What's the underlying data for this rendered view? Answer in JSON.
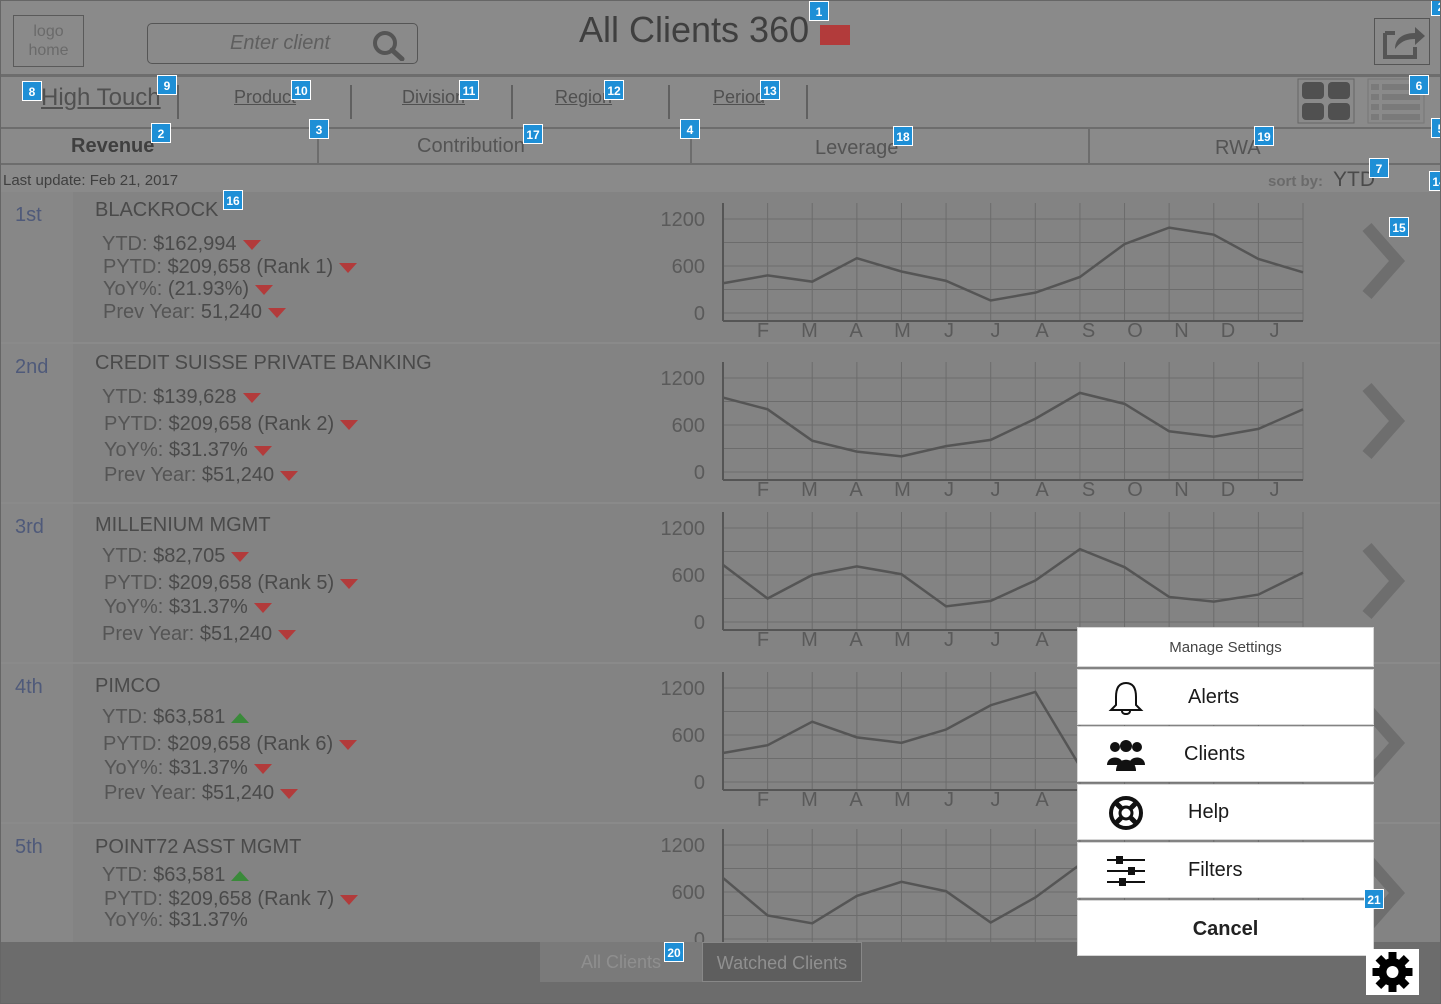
{
  "header": {
    "logo_text": "logo home",
    "search_placeholder": "Enter client",
    "title": "All Clients 360"
  },
  "filters": {
    "items": [
      "High Touch",
      "Product",
      "Division",
      "Region",
      "Period"
    ]
  },
  "metric_tabs": [
    "Revenue",
    "Contribution",
    "Leverage",
    "RWA"
  ],
  "status": {
    "last_update": "Last update: Feb 21, 2017",
    "sort_label": "sort by:",
    "sort_value": "YTD"
  },
  "chart_axes": {
    "y_ticks": [
      "1200",
      "600",
      "0"
    ],
    "months": [
      "F",
      "M",
      "A",
      "M",
      "J",
      "J",
      "A",
      "S",
      "O",
      "N",
      "D",
      "J"
    ]
  },
  "clients": [
    {
      "rank": "1st",
      "name": "BLACKROCK",
      "ytd_label": "YTD:",
      "ytd": "$162,994",
      "ytd_dir": "down",
      "pytd_label": "PYTD:",
      "pytd": "$209,658 (Rank 1)",
      "pytd_dir": "down",
      "yoy_label": "YoY%:",
      "yoy": "(21.93%)",
      "yoy_dir": "down",
      "prev_label": "Prev Year:",
      "prev": "51,240",
      "prev_dir": "down"
    },
    {
      "rank": "2nd",
      "name": "CREDIT SUISSE PRIVATE BANKING",
      "ytd_label": "YTD:",
      "ytd": "$139,628",
      "ytd_dir": "down",
      "pytd_label": "PYTD:",
      "pytd": "$209,658 (Rank 2)",
      "pytd_dir": "down",
      "yoy_label": "YoY%:",
      "yoy": "$31.37%",
      "yoy_dir": "down",
      "prev_label": "Prev Year:",
      "prev": "$51,240",
      "prev_dir": "down"
    },
    {
      "rank": "3rd",
      "name": "MILLENIUM MGMT",
      "ytd_label": "YTD:",
      "ytd": "$82,705",
      "ytd_dir": "down",
      "pytd_label": "PYTD:",
      "pytd": "$209,658 (Rank 5)",
      "pytd_dir": "down",
      "yoy_label": "YoY%:",
      "yoy": "$31.37%",
      "yoy_dir": "down",
      "prev_label": "Prev Year:",
      "prev": "$51,240",
      "prev_dir": "down"
    },
    {
      "rank": "4th",
      "name": "PIMCO",
      "ytd_label": "YTD:",
      "ytd": "$63,581",
      "ytd_dir": "up",
      "pytd_label": "PYTD:",
      "pytd": "$209,658 (Rank 6)",
      "pytd_dir": "down",
      "yoy_label": "YoY%:",
      "yoy": "$31.37%",
      "yoy_dir": "down",
      "prev_label": "Prev Year:",
      "prev": "$51,240",
      "prev_dir": "down"
    },
    {
      "rank": "5th",
      "name": "POINT72 ASST MGMT",
      "ytd_label": "YTD:",
      "ytd": "$63,581",
      "ytd_dir": "up",
      "pytd_label": "PYTD:",
      "pytd": "$209,658 (Rank 7)",
      "pytd_dir": "down",
      "yoy_label": "YoY%:",
      "yoy": "$31.37%",
      "yoy_dir": "none"
    }
  ],
  "chart_data": [
    {
      "type": "line",
      "x": [
        "F",
        "M",
        "A",
        "M",
        "J",
        "J",
        "A",
        "S",
        "O",
        "N",
        "D",
        "J"
      ],
      "ylim": [
        0,
        1200
      ],
      "values": [
        380,
        480,
        400,
        700,
        530,
        410,
        160,
        260,
        460,
        880,
        1090,
        1000,
        690,
        520
      ]
    },
    {
      "type": "line",
      "x": [
        "F",
        "M",
        "A",
        "M",
        "J",
        "J",
        "A",
        "S",
        "O",
        "N",
        "D",
        "J"
      ],
      "ylim": [
        0,
        1200
      ],
      "values": [
        950,
        800,
        400,
        260,
        200,
        330,
        410,
        680,
        1010,
        870,
        520,
        450,
        550,
        800
      ]
    },
    {
      "type": "line",
      "x": [
        "F",
        "M",
        "A",
        "M",
        "J",
        "J",
        "A",
        "S",
        "O",
        "N",
        "D",
        "J"
      ],
      "ylim": [
        0,
        1200
      ],
      "values": [
        730,
        300,
        600,
        710,
        610,
        200,
        270,
        530,
        930,
        700,
        320,
        260,
        350,
        630
      ]
    },
    {
      "type": "line",
      "x": [
        "F",
        "M",
        "A",
        "M",
        "J",
        "J",
        "A",
        "S",
        "O",
        "N",
        "D",
        "J"
      ],
      "ylim": [
        0,
        1200
      ],
      "values": [
        370,
        470,
        770,
        570,
        500,
        670,
        980,
        1150,
        200
      ]
    },
    {
      "type": "line",
      "x": [
        "F",
        "M",
        "A",
        "M",
        "J",
        "J",
        "A",
        "S",
        "O",
        "N",
        "D",
        "J"
      ],
      "ylim": [
        0,
        1200
      ],
      "values": [
        780,
        300,
        200,
        550,
        730,
        610,
        210,
        530,
        950
      ]
    }
  ],
  "settings_menu": {
    "title": "Manage Settings",
    "items": [
      {
        "label": "Alerts",
        "icon": "bell-icon"
      },
      {
        "label": "Clients",
        "icon": "users-icon"
      },
      {
        "label": "Help",
        "icon": "lifebuoy-icon"
      },
      {
        "label": "Filters",
        "icon": "sliders-icon"
      }
    ],
    "cancel": "Cancel"
  },
  "bottom_tabs": [
    "All Clients",
    "Watched Clients"
  ],
  "markers": [
    "1",
    "2",
    "3",
    "4",
    "5",
    "6",
    "7",
    "8",
    "9",
    "10",
    "11",
    "12",
    "13",
    "14",
    "15",
    "16",
    "17",
    "18",
    "19",
    "20",
    "21"
  ],
  "colors": {
    "down": "#b23b3b",
    "up": "#3a8a3a",
    "marker": "#1e8fd6"
  }
}
